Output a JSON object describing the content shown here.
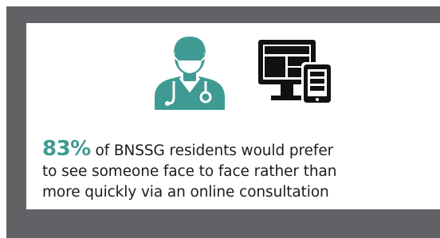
{
  "infographic": {
    "statistic": "83%",
    "text_line1_rest": " of BNSSG residents would prefer",
    "text_line2": "to see someone face to face rather than",
    "text_line3": "more quickly via an online consultation"
  },
  "icons": {
    "left": "doctor-icon",
    "right": "computer-and-phone-icon"
  },
  "colors": {
    "frame": "#616265",
    "accent_teal": "#3f9a93",
    "text": "#1c1c1c",
    "icon_dark": "#111111"
  }
}
